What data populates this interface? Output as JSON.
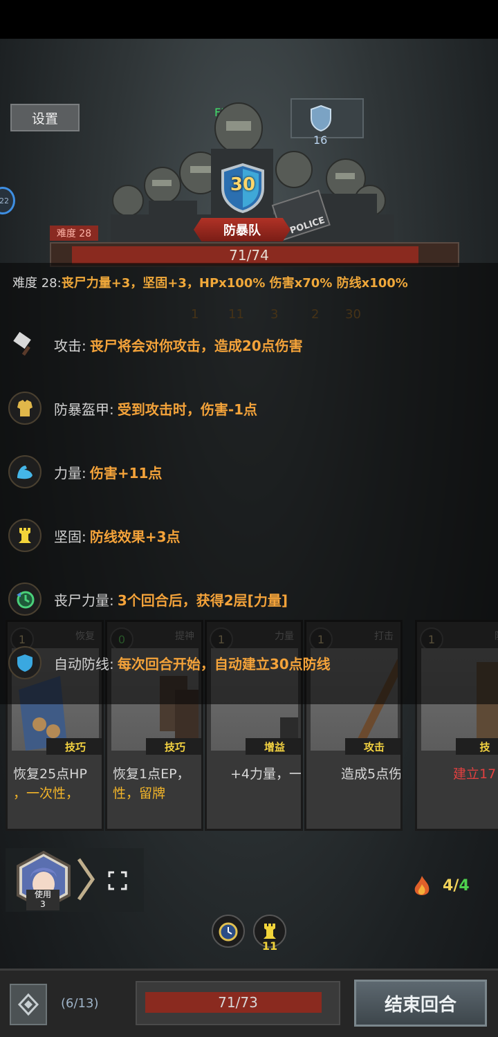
{
  "settings_label": "设置",
  "fps": "FPS49",
  "left_badge": "22",
  "enemy": {
    "shield_bubble_value": "16",
    "block_value": "30",
    "name": "防暴队",
    "difficulty_tag": "难度 28",
    "hp_text": "71/74",
    "hp_fraction": 0.959
  },
  "difficulty_line": {
    "label": "难度 28:",
    "text": "丧尸力量+3，坚固+3，HPx100% 伤害x70% 防线x100%"
  },
  "status_counts": [
    "1",
    "11",
    "3",
    "2",
    "30"
  ],
  "effects": [
    {
      "icon": "cleaver-icon",
      "label": "攻击:",
      "desc": "丧尸将会对你攻击，造成20点伤害"
    },
    {
      "icon": "armor-icon",
      "label": "防暴盔甲:",
      "desc": "受到攻击时，伤害-1点"
    },
    {
      "icon": "muscle-icon",
      "label": "力量:",
      "desc": "伤害+11点"
    },
    {
      "icon": "tower-icon",
      "label": "坚固:",
      "desc": "防线效果+3点"
    },
    {
      "icon": "timer-icon",
      "label": "丧尸力量:",
      "desc": "3个回合后，获得2层[力量]"
    },
    {
      "icon": "shield-icon",
      "label": "自动防线:",
      "desc": "每次回合开始，自动建立30点防线"
    }
  ],
  "cards": [
    {
      "cost": "1",
      "type": "恢复",
      "tag": "技巧",
      "line1": "恢复25点HP",
      "line2": "，一次性，"
    },
    {
      "cost": "0",
      "type": "提神",
      "tag": "技巧",
      "line1": "恢复1点EP，",
      "line2": "性，留牌"
    },
    {
      "cost": "1",
      "type": "力量",
      "tag": "增益",
      "line1": "+4力量，一",
      "line2": ""
    },
    {
      "cost": "1",
      "type": "打击",
      "tag": "攻击",
      "line1": "造成5点伤",
      "line2": ""
    },
    {
      "cost": "1",
      "type": "防",
      "tag": "技",
      "line1": "建立17",
      "line2": ""
    }
  ],
  "hero": {
    "use_label": "使用",
    "use_count": "3"
  },
  "energy": {
    "current": "4",
    "max": "4"
  },
  "player_buff_value": "11",
  "bottom": {
    "deck_count": "(6/13)",
    "player_hp_text": "71/73",
    "player_hp_fraction": 0.973,
    "end_turn_label": "结束回合"
  }
}
